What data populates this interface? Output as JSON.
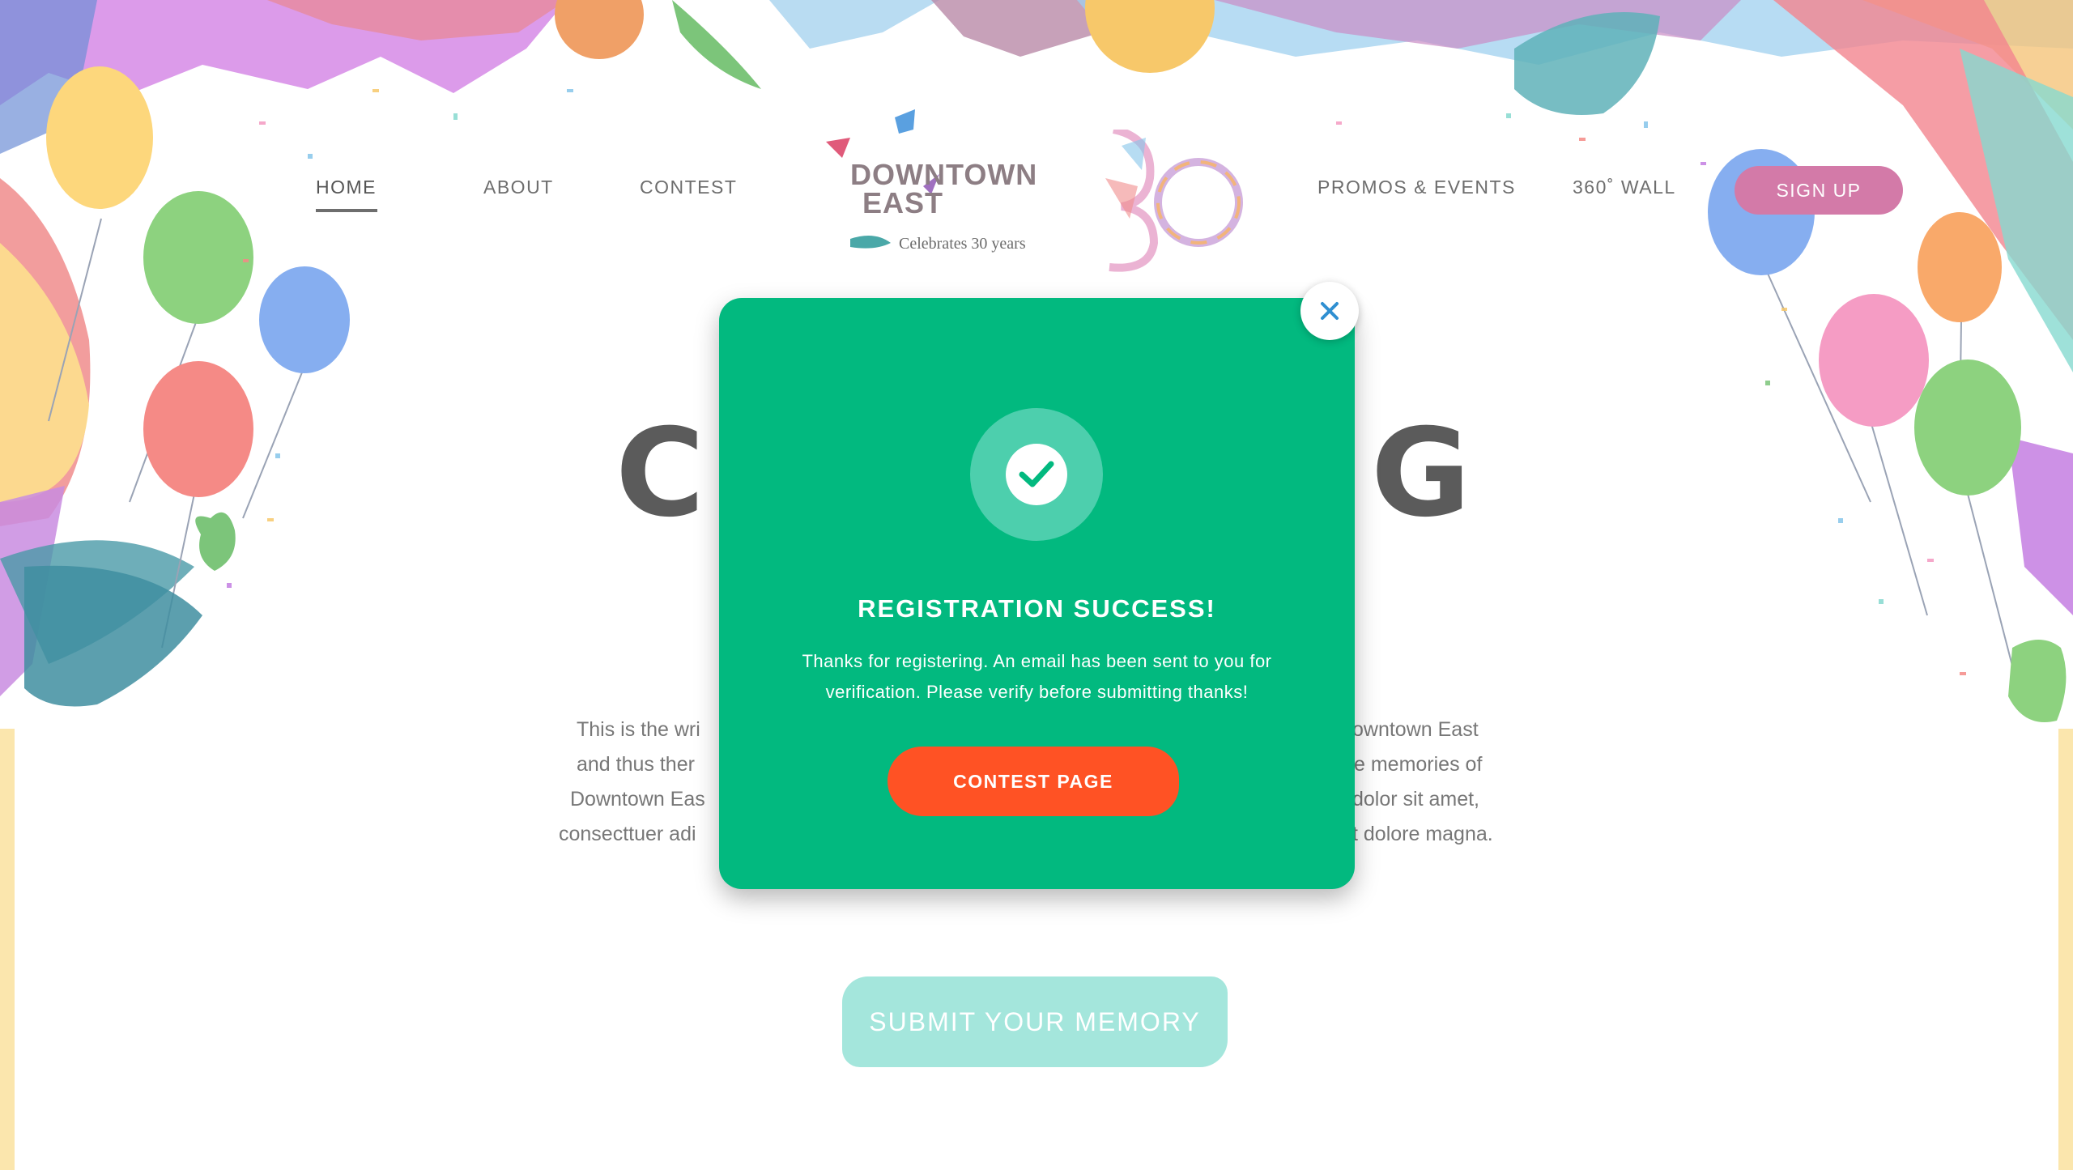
{
  "nav": {
    "home": "HOME",
    "about": "ABOUT",
    "contest": "CONTEST",
    "promos": "PROMOS & EVENTS",
    "wall": "360˚ WALL",
    "signup": "SIGN UP"
  },
  "logo": {
    "line1": "DOWNTOWN",
    "line2": "EAST",
    "tagline": "Celebrates 30 years"
  },
  "hero": {
    "title_left": "C",
    "title_right": "G",
    "paragraph_left": [
      "This is the wri",
      "and thus ther",
      "Downtown Eas",
      "consecttuer adi"
    ],
    "paragraph_right": [
      "owntown East",
      "e memories of",
      "dolor sit amet,",
      "t dolore magna."
    ],
    "submit": "SUBMIT YOUR MEMORY"
  },
  "modal": {
    "title": "REGISTRATION SUCCESS!",
    "message": "Thanks for registering. An email has been sent to you for verification. Please verify before submitting thanks!",
    "button": "CONTEST PAGE"
  },
  "icons": {
    "check": "check-icon",
    "close": "close-icon"
  },
  "colors": {
    "modal_bg": "#02b97f",
    "modal_button": "#ff5224",
    "signup_bg": "#d37aa8",
    "submit_bg": "#a4e6dc",
    "close_icon": "#2f8fd1"
  }
}
